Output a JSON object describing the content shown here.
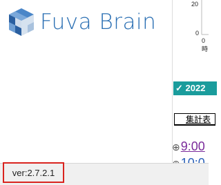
{
  "app": {
    "logo_text": "Fuva Brain",
    "logo_icon": "cube-logo-icon",
    "brand_color": "#2a6fb3"
  },
  "chart_fragment": {
    "tick_top": "20",
    "tick_bottom": "0",
    "x_tick": "0時"
  },
  "date_banner": {
    "text": "✓ 2022",
    "color": "#1a9c9c"
  },
  "tab": {
    "label": "集計表"
  },
  "schedule": {
    "items": [
      {
        "time": "9:00",
        "icon": "plus-circle-icon"
      },
      {
        "time": "10:0",
        "icon": "plus-circle-icon"
      }
    ]
  },
  "footer": {
    "version": "ver:2.7.2.1",
    "highlight_color": "#d9231e"
  }
}
